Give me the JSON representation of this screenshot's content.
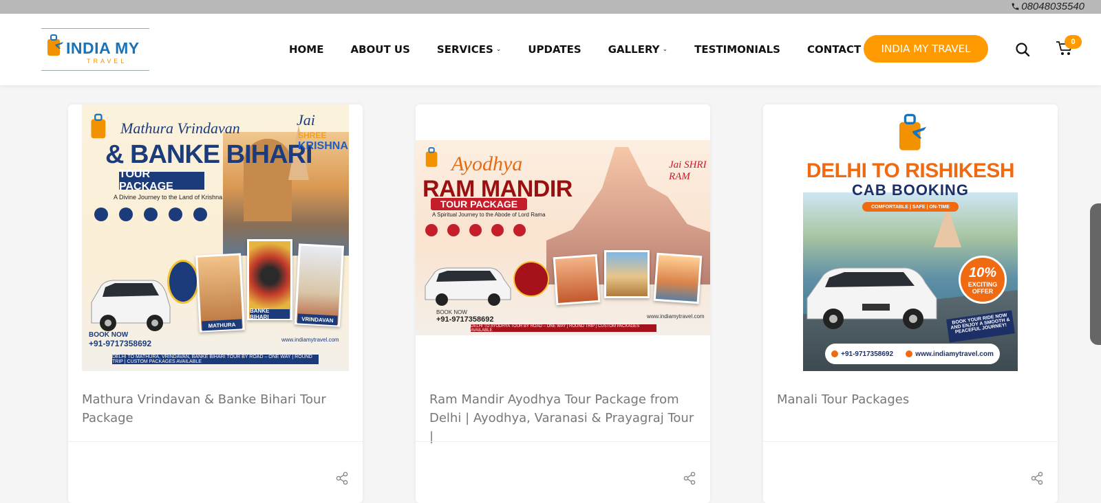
{
  "topbar": {
    "phone": "08048035540"
  },
  "header": {
    "logo": {
      "word": "INDIA MY",
      "sub": "TRAVEL"
    },
    "nav": [
      {
        "label": "HOME",
        "has_dropdown": false
      },
      {
        "label": "ABOUT US",
        "has_dropdown": false
      },
      {
        "label": "SERVICES",
        "has_dropdown": true
      },
      {
        "label": "UPDATES",
        "has_dropdown": false
      },
      {
        "label": "GALLERY",
        "has_dropdown": true
      },
      {
        "label": "TESTIMONIALS",
        "has_dropdown": false
      },
      {
        "label": "CONTACT",
        "has_dropdown": false
      }
    ],
    "cta_label": "INDIA MY TRAVEL",
    "cart_count": "0"
  },
  "colors": {
    "accent": "#ff9a00",
    "nav_text": "#111111",
    "card_title": "#777777"
  },
  "cards": [
    {
      "title": "Mathura Vrindavan & Banke Bihari Tour Package",
      "poster": {
        "line1": "Mathura Vrindavan",
        "line2": "& BANKE BIHARI",
        "band": "TOUR PACKAGE",
        "tagline": "A Divine Journey to the Land of Krishna",
        "corner1": "Jai",
        "corner2": "SHREE",
        "corner3": "KRISHNA",
        "frames": [
          "MATHURA",
          "BANKE BIHARI",
          "VRINDAVAN"
        ],
        "book_label": "BOOK NOW",
        "phone": "+91-9717358692",
        "website": "www.indiamytravel.com",
        "footer": "DELHI TO MATHURA, VRINDAVAN, BANKE BIHARI TOUR BY ROAD – ONE WAY | ROUND TRIP | CUSTOM PACKAGES AVAILABLE"
      }
    },
    {
      "title": "Ram Mandir Ayodhya Tour Package from Delhi | Ayodhya, Varanasi & Prayagraj Tour |",
      "poster": {
        "line1": "Ayodhya",
        "line2": "RAM MANDIR",
        "band": "TOUR PACKAGE",
        "tagline": "A Spiritual Journey to the Abode of Lord Rama",
        "corner": "Jai SHRI RAM",
        "book_label": "BOOK NOW",
        "phone": "+91-9717358692",
        "website": "www.indiamytravel.com",
        "footer": "DELHI TO AYODHYA TOUR BY ROAD – ONE WAY | ROUND TRIP | CUSTOM PACKAGES AVAILABLE"
      }
    },
    {
      "title": "Manali Tour Packages",
      "poster": {
        "line1": "DELHI TO RISHIKESH",
        "line2": "CAB BOOKING",
        "pill": "COMFORTABLE | SAFE | ON-TIME",
        "offer_pct": "10%",
        "offer_l1": "EXCITING",
        "offer_l2": "OFFER",
        "ride": "BOOK YOUR RIDE NOW AND ENJOY A SMOOTH & PEACEFUL JOURNEY!",
        "phone": "+91-9717358692",
        "website": "www.indiamytravel.com"
      }
    }
  ]
}
